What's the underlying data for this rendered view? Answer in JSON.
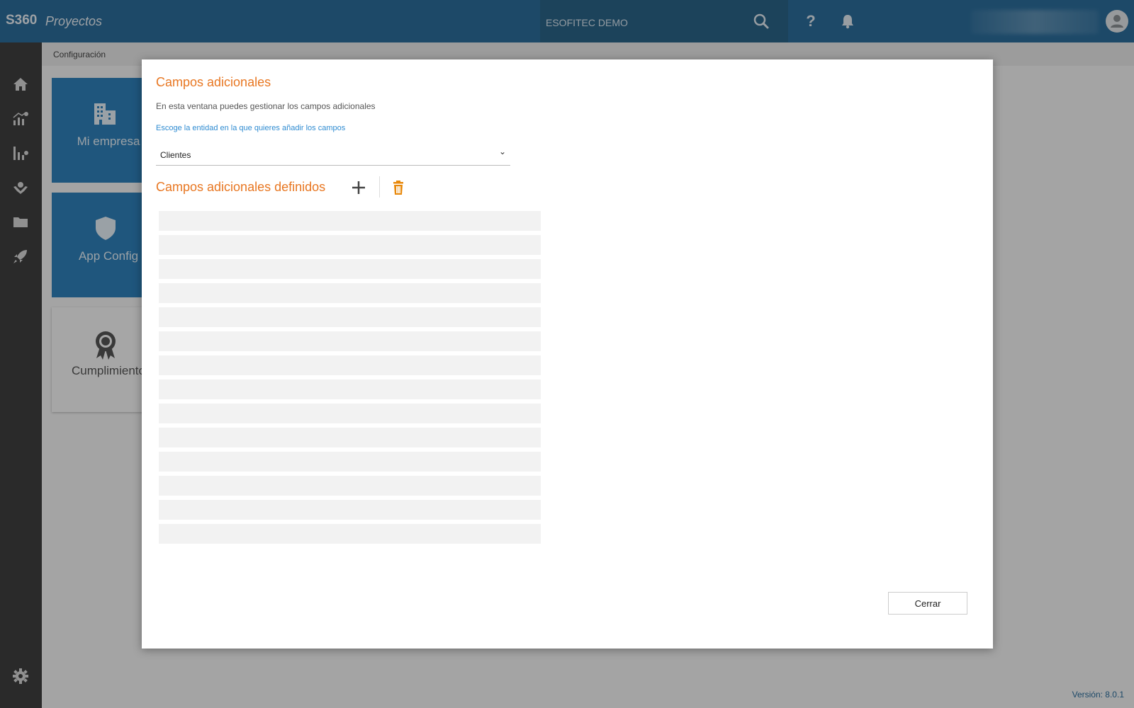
{
  "header": {
    "brand": "S360",
    "product": "Proyectos",
    "company": "ESOFITEC DEMO",
    "icons": [
      "search-icon",
      "help-icon",
      "bell-icon",
      "user-icon"
    ],
    "help_glyph": "?"
  },
  "sidebar": {
    "items": [
      "home-icon",
      "analytics-icon",
      "chart-icon",
      "hands-icon",
      "folder-icon",
      "rocket-icon"
    ],
    "bottom": "gear-icon"
  },
  "page": {
    "breadcrumb": "Configuración",
    "tiles": [
      {
        "label": "Mi empresa",
        "icon": "building-icon"
      },
      {
        "label": "App Config",
        "icon": "shield-icon"
      },
      {
        "label": "Cumplimiento",
        "icon": "award-icon"
      }
    ],
    "version": "Versión: 8.0.1"
  },
  "modal": {
    "title": "Campos adicionales",
    "description": "En esta ventana puedes gestionar los campos adicionales",
    "entity_label": "Escoge la entidad en la que quieres añadir los campos",
    "entity_value": "Clientes",
    "section_title": "Campos adicionales definidos",
    "close_label": "Cerrar",
    "placeholder_rows": 14
  },
  "colors": {
    "header": "#2b6c9a",
    "sidebar": "#3e3e3e",
    "accent_orange": "#e87722",
    "link_blue": "#2e8bd1",
    "tile_blue": "#2e7fb8"
  }
}
